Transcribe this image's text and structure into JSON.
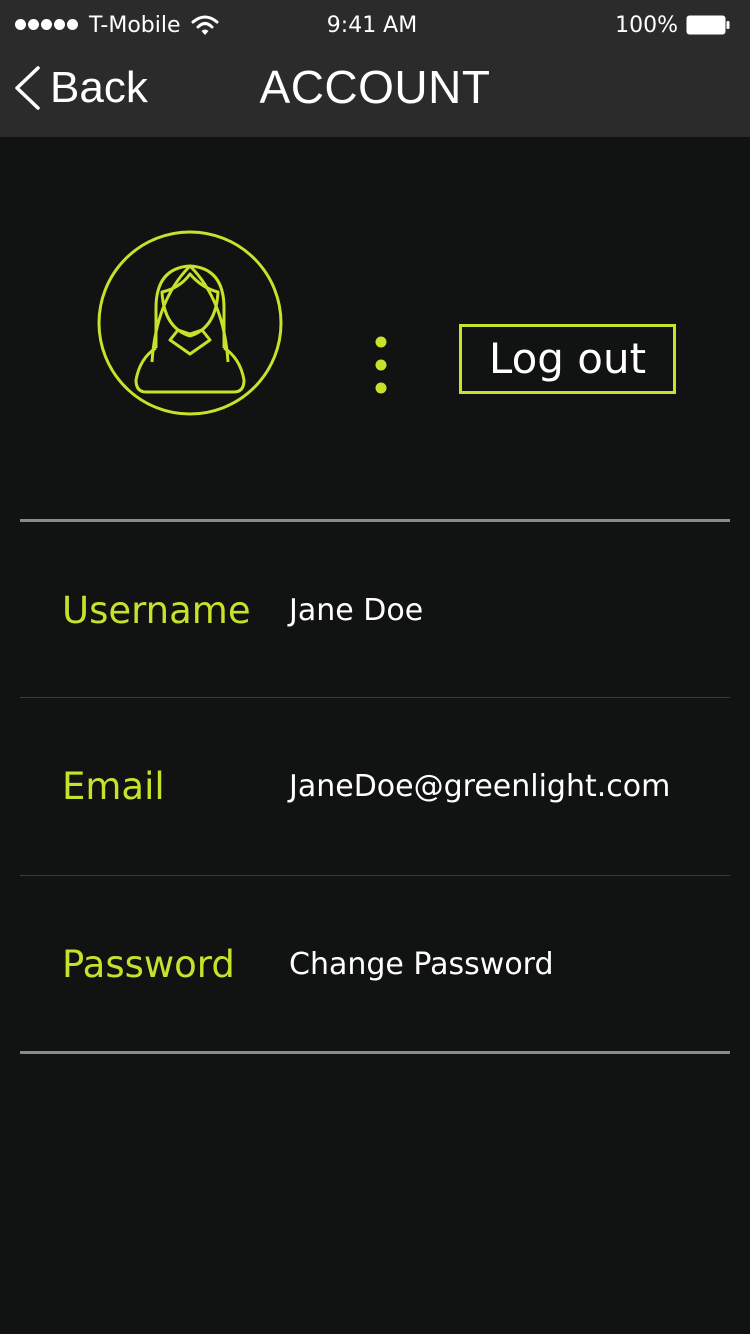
{
  "status_bar": {
    "carrier": "T-Mobile",
    "time": "9:41 AM",
    "battery": "100%"
  },
  "nav": {
    "back_label": "Back",
    "title": "ACCOUNT"
  },
  "profile": {
    "avatar_icon": "user-profile-icon",
    "more_icon": "more-vertical-icon",
    "logout_label": "Log out"
  },
  "fields": {
    "username": {
      "label": "Username",
      "value": "Jane Doe"
    },
    "email": {
      "label": "Email",
      "value": "JaneDoe@greenlight.com"
    },
    "password": {
      "label": "Password",
      "value": "Change Password"
    }
  },
  "colors": {
    "accent": "#c8e12b",
    "background": "#111212",
    "header": "#2b2b2b"
  }
}
